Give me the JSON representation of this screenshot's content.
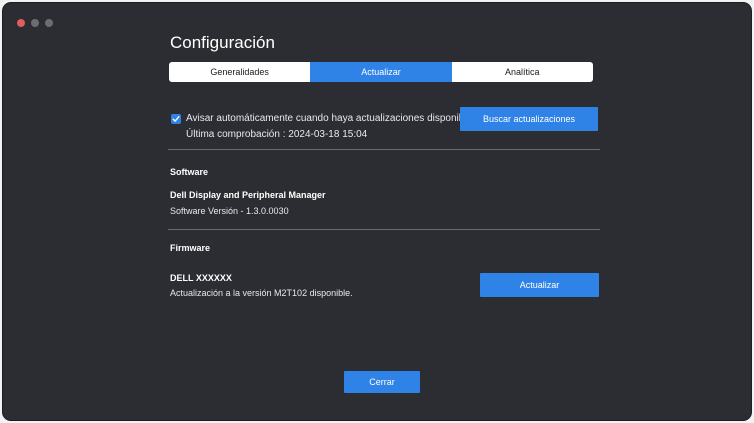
{
  "window": {
    "title": "Configuración"
  },
  "tabs": [
    {
      "label": "Generalidades",
      "active": false
    },
    {
      "label": "Actualizar",
      "active": true
    },
    {
      "label": "Analítica",
      "active": false
    }
  ],
  "auto_update": {
    "checked": true,
    "label": "Avisar automáticamente cuando haya actualizaciones disponibles",
    "last_check": "Última comprobación : 2024-03-18 15:04",
    "search_button": "Buscar actualizaciones"
  },
  "software": {
    "heading": "Software",
    "name": "Dell Display and Peripheral Manager",
    "version": "Software Versión - 1.3.0.0030"
  },
  "firmware": {
    "heading": "Firmware",
    "device": "DELL XXXXXX",
    "status": "Actualización a la versión M2T102 disponible.",
    "update_button": "Actualizar"
  },
  "footer": {
    "close_button": "Cerrar"
  },
  "colors": {
    "background": "#2b2d33",
    "accent": "#2f82e6",
    "close_dot": "#e25c58"
  }
}
